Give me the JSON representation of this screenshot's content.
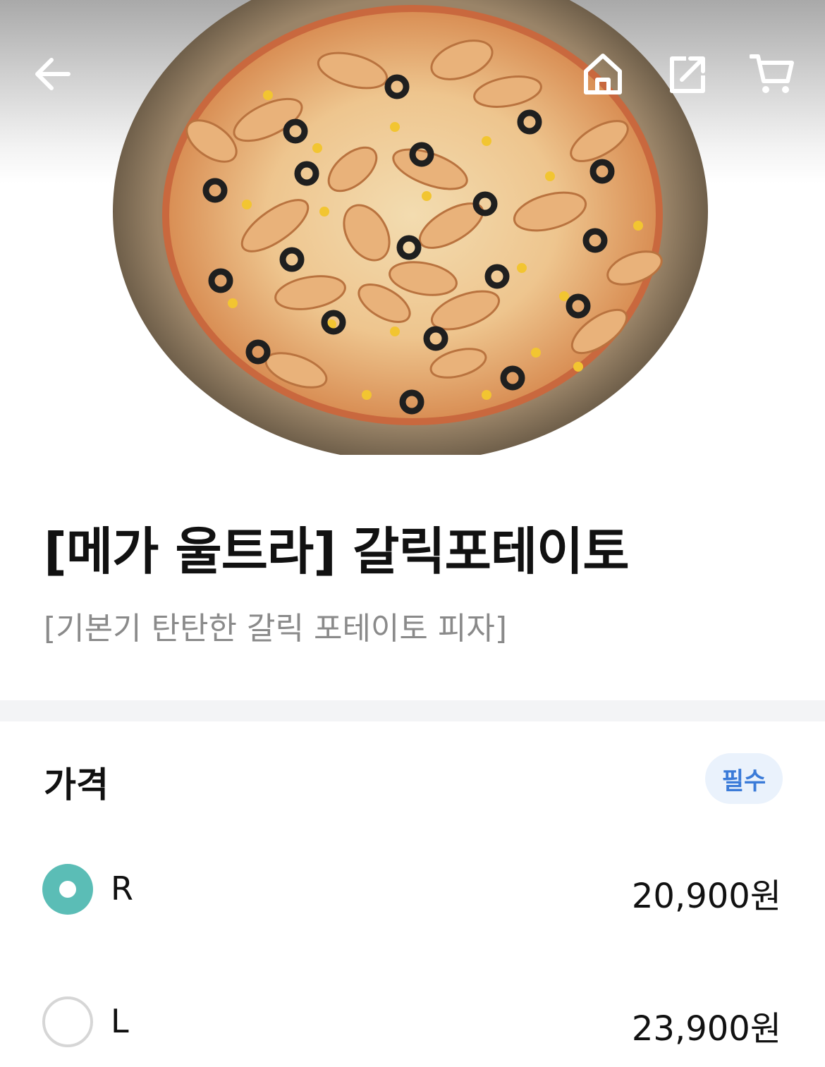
{
  "header": {
    "back_icon": "arrow-left-icon",
    "home_icon": "home-icon",
    "share_icon": "share-icon",
    "cart_icon": "cart-icon"
  },
  "product": {
    "image": "pizza-photo",
    "title": "[메가 울트라] 갈릭포테이토",
    "description": "[기본기 탄탄한 갈릭 포테이토 피자]"
  },
  "price_section": {
    "title": "가격",
    "badge": "필수",
    "options": [
      {
        "label": "R",
        "price": "20,900원",
        "selected": true
      },
      {
        "label": "L",
        "price": "23,900원",
        "selected": false
      }
    ]
  },
  "colors": {
    "accent": "#5bbdb6",
    "badge_text": "#3b7bd8",
    "badge_bg": "#eaf2fc",
    "subtitle": "#8a8a8a",
    "divider": "#f3f4f6"
  }
}
